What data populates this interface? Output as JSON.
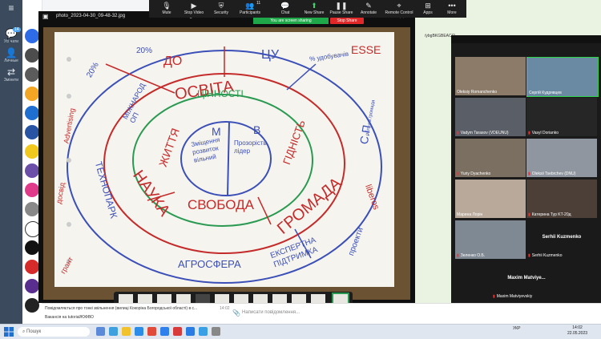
{
  "telegram": {
    "unread_badge": "14",
    "nav": [
      "Усі чати",
      "Личные",
      "Змінити"
    ]
  },
  "viewer": {
    "filename": "photo_2023-04-30_09-48-32.jpg"
  },
  "zoom": {
    "toolbar": [
      "Mute",
      "Stop Video",
      "Security",
      "Participants",
      "Chat",
      "New Share",
      "Pause Share",
      "Annotate",
      "Remote Control",
      "Apps",
      "More"
    ],
    "participants_count": "11",
    "sharing_text": "You are screen sharing",
    "stop_share_label": "Stop Share",
    "address_fragment": "/ybgBKGBEACI2",
    "tiles": [
      {
        "name": "Oleksiy Romanchenko"
      },
      {
        "name": "Сергій Кудрявцев"
      },
      {
        "name": "Vadym Tarasov (VDEUNU)"
      },
      {
        "name": "Vasyl Dorianko"
      },
      {
        "name": "Yuriy Dyachenko"
      },
      {
        "name": "Oleksii Tsebrchev (DNU)"
      },
      {
        "name": "Марина Лорін"
      },
      {
        "name": "Катерина Тур KT-20д"
      },
      {
        "name": "Зеленко О.Б."
      },
      {
        "name": "Serhii Kuzmenko",
        "center": "Serhii Kuzmenko"
      },
      {
        "name": "Maxim Matviyevskiy",
        "center": "Maxim  Matviye..."
      }
    ]
  },
  "chat": {
    "message_1": "Повідомляється про тонкі звільнення (вилиці Кокоріна Богородської області) в с...",
    "message_2": "Вакансія на tutorial/ЮФВО",
    "input_placeholder": "Написати повідомлення...",
    "time_1": "14:02"
  },
  "board": {
    "outer_left": "20%",
    "top_left": "20%",
    "do": "ДО",
    "cu": "ЦУ",
    "udobstvo": "% удобувачів",
    "esse": "ESSE",
    "mizhnar": "МІЖНАРОД ОП",
    "osvita": "ОСВІТА",
    "cinnosti": "ЦІННОСТІ",
    "sp": "С.П.",
    "m": "М",
    "v": "В",
    "zmishchennia": "Зміщення розвиток вільний",
    "prozorist": "Прозорість лідер",
    "gidnist": "ГІДНІСТЬ",
    "zhyttia": "ЖИТТЯ",
    "nauka": "НАУКА",
    "svoboda": "СВОБОДА",
    "gromada": "ГРОМАДА",
    "tekhnopark": "ТЕХНОПАРК",
    "agrosfera": "АГРОСФЕРА",
    "ekspertna": "ЕКСПЕРТНА ПІДТРИМКА",
    "liberos": "liberos",
    "proekty": "проекти",
    "advertising": "Advertising",
    "dosvid": "досвід",
    "grant": "грант",
    "obl": "обл.-на громада"
  },
  "taskbar": {
    "search_placeholder": "Пошук",
    "lang": "УКР",
    "time": "14:02",
    "date": "22.05.2023"
  }
}
